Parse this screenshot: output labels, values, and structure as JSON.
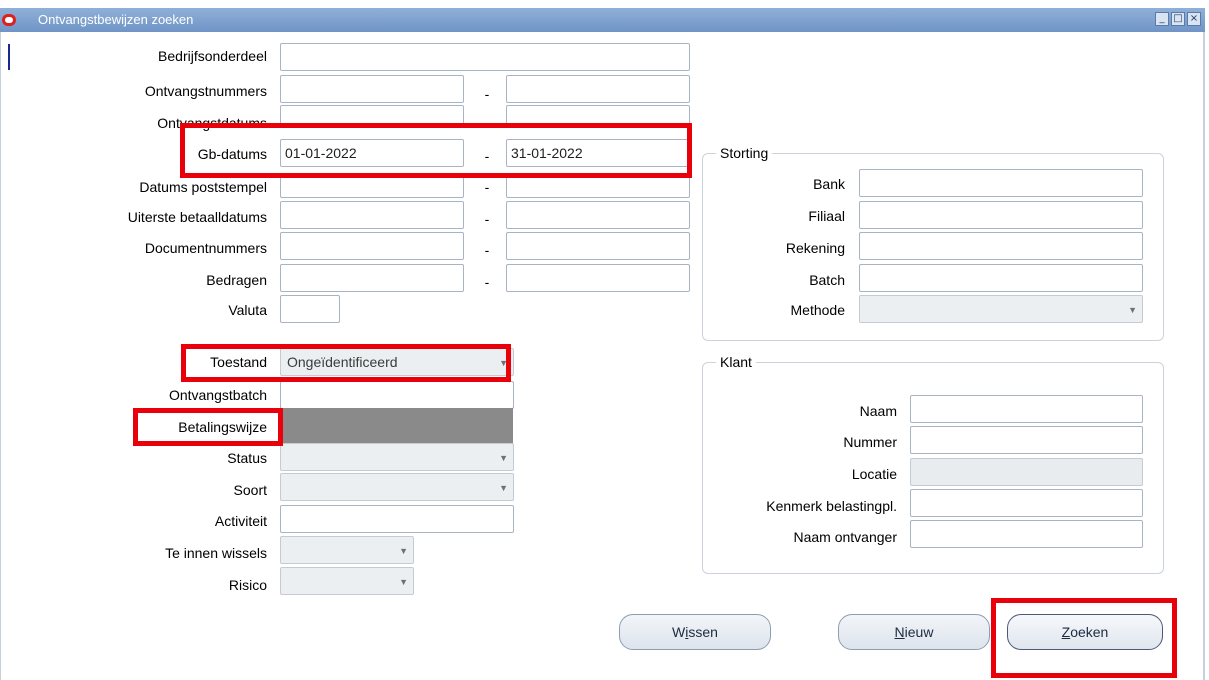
{
  "window": {
    "title": "Ontvangstbewijzen zoeken",
    "controls": [
      "_",
      "□",
      "×"
    ]
  },
  "left": {
    "bedrijfsonderdeel": {
      "label": "Bedrijfsonderdeel",
      "value": ""
    },
    "ontvangstnummers": {
      "label": "Ontvangstnummers",
      "from": "",
      "to": ""
    },
    "ontvangstdatums": {
      "label": "Ontvangstdatums",
      "from": "",
      "to": ""
    },
    "gb_datums": {
      "label": "Gb-datums",
      "from": "01-01-2022",
      "to": "31-01-2022"
    },
    "datums_poststempel": {
      "label": "Datums poststempel",
      "from": "",
      "to": ""
    },
    "uiterste_betaalldatums": {
      "label": "Uiterste betaalldatums",
      "from": "",
      "to": ""
    },
    "documentnummers": {
      "label": "Documentnummers",
      "from": "",
      "to": ""
    },
    "bedragen": {
      "label": "Bedragen",
      "from": "",
      "to": ""
    },
    "valuta": {
      "label": "Valuta",
      "value": ""
    },
    "toestand": {
      "label": "Toestand",
      "value": "Ongeïdentificeerd"
    },
    "ontvangstbatch": {
      "label": "Ontvangstbatch",
      "value": ""
    },
    "betalingswijze": {
      "label": "Betalingswijze",
      "value": ""
    },
    "status": {
      "label": "Status",
      "value": ""
    },
    "soort": {
      "label": "Soort",
      "value": ""
    },
    "activiteit": {
      "label": "Activiteit",
      "value": ""
    },
    "te_innen_wissels": {
      "label": "Te innen wissels",
      "value": ""
    },
    "risico": {
      "label": "Risico",
      "value": ""
    },
    "range_separator": "-"
  },
  "storting": {
    "title": "Storting",
    "bank": {
      "label": "Bank",
      "value": ""
    },
    "filiaal": {
      "label": "Filiaal",
      "value": ""
    },
    "rekening": {
      "label": "Rekening",
      "value": ""
    },
    "batch": {
      "label": "Batch",
      "value": ""
    },
    "methode": {
      "label": "Methode",
      "value": ""
    }
  },
  "klant": {
    "title": "Klant",
    "naam": {
      "label": "Naam",
      "value": ""
    },
    "nummer": {
      "label": "Nummer",
      "value": ""
    },
    "locatie": {
      "label": "Locatie",
      "value": ""
    },
    "kenmerk": {
      "label": "Kenmerk belastingpl.",
      "value": ""
    },
    "naam_ontvanger": {
      "label": "Naam ontvanger",
      "value": ""
    }
  },
  "buttons": {
    "wissen": {
      "pre": "W",
      "key": "i",
      "post": "ssen"
    },
    "nieuw": {
      "pre": "",
      "key": "N",
      "post": "ieuw"
    },
    "zoeken": {
      "pre": "",
      "key": "Z",
      "post": "oeken"
    }
  },
  "colors": {
    "highlight": "#e8000b",
    "titlebar": "#7fa2d0",
    "redacted": "#8a8a8a"
  }
}
